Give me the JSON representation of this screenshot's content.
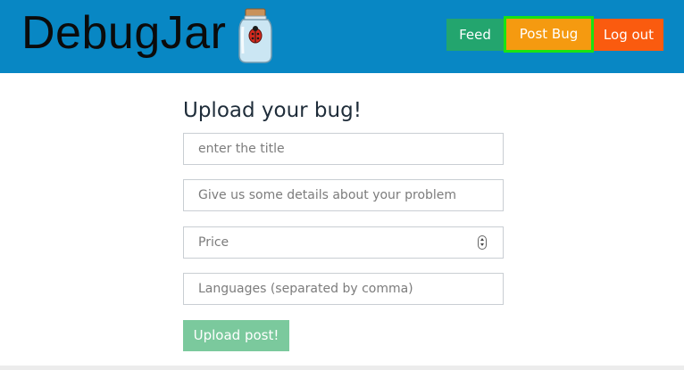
{
  "app": {
    "logo_text": "DebugJar",
    "logo_icon": "jar-with-ladybug-icon"
  },
  "nav": {
    "feed_label": "Feed",
    "post_bug_label": "Post Bug",
    "logout_label": "Log out"
  },
  "form": {
    "heading": "Upload your bug!",
    "title_placeholder": "enter the title",
    "details_placeholder": "Give us some details about your problem",
    "price_placeholder": "Price",
    "languages_placeholder": "Languages (separated by comma)",
    "submit_label": "Upload post!"
  },
  "colors": {
    "header_bg": "#0887c4",
    "feed_button": "#23a56e",
    "post_bug_button": "#f59a10",
    "post_bug_highlight": "#19e312",
    "logout_button": "#fa5b0f",
    "submit_button": "#7bc99d"
  }
}
